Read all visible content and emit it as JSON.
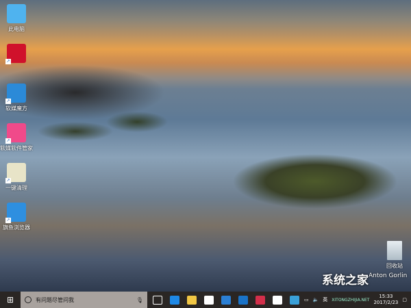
{
  "desktop_icons": [
    {
      "label": "此电脑",
      "icon": "computer-icon",
      "color": "#4fb3ef"
    },
    {
      "label": "",
      "icon": "red-app-icon",
      "color": "#d0112b"
    },
    {
      "label": "软媒魔方",
      "icon": "rubik-cube-icon",
      "color": "#2b8ad8"
    },
    {
      "label": "软媒软件管家",
      "icon": "software-manager-icon",
      "color": "#f04a8a"
    },
    {
      "label": "一键清理",
      "icon": "cleaner-icon",
      "color": "#e8e4c8"
    },
    {
      "label": "旗鱼浏览器",
      "icon": "swordfish-browser-icon",
      "color": "#2e8fe0"
    }
  ],
  "recycle_bin": {
    "label": "回收站"
  },
  "wallpaper_credit": "Anton Gorlin",
  "watermark": {
    "title": "系统之家",
    "url": "XITONGZHIJIA.NET"
  },
  "taskbar": {
    "search_placeholder": "有问题尽管问我",
    "apps": [
      {
        "name": "task-view",
        "color": "#2a2624"
      },
      {
        "name": "edge",
        "color": "#1e88e5"
      },
      {
        "name": "file-explorer",
        "color": "#f2c744"
      },
      {
        "name": "store",
        "color": "#ffffff"
      },
      {
        "name": "globe-browser",
        "color": "#2b7fd4"
      },
      {
        "name": "outlook",
        "color": "#1a73c8"
      },
      {
        "name": "red-app",
        "color": "#d32f4a"
      },
      {
        "name": "mail",
        "color": "#ffffff"
      },
      {
        "name": "photos",
        "color": "#3aa0d8"
      }
    ],
    "time": "15:33",
    "date": "2017/2/23",
    "ime": "英"
  }
}
